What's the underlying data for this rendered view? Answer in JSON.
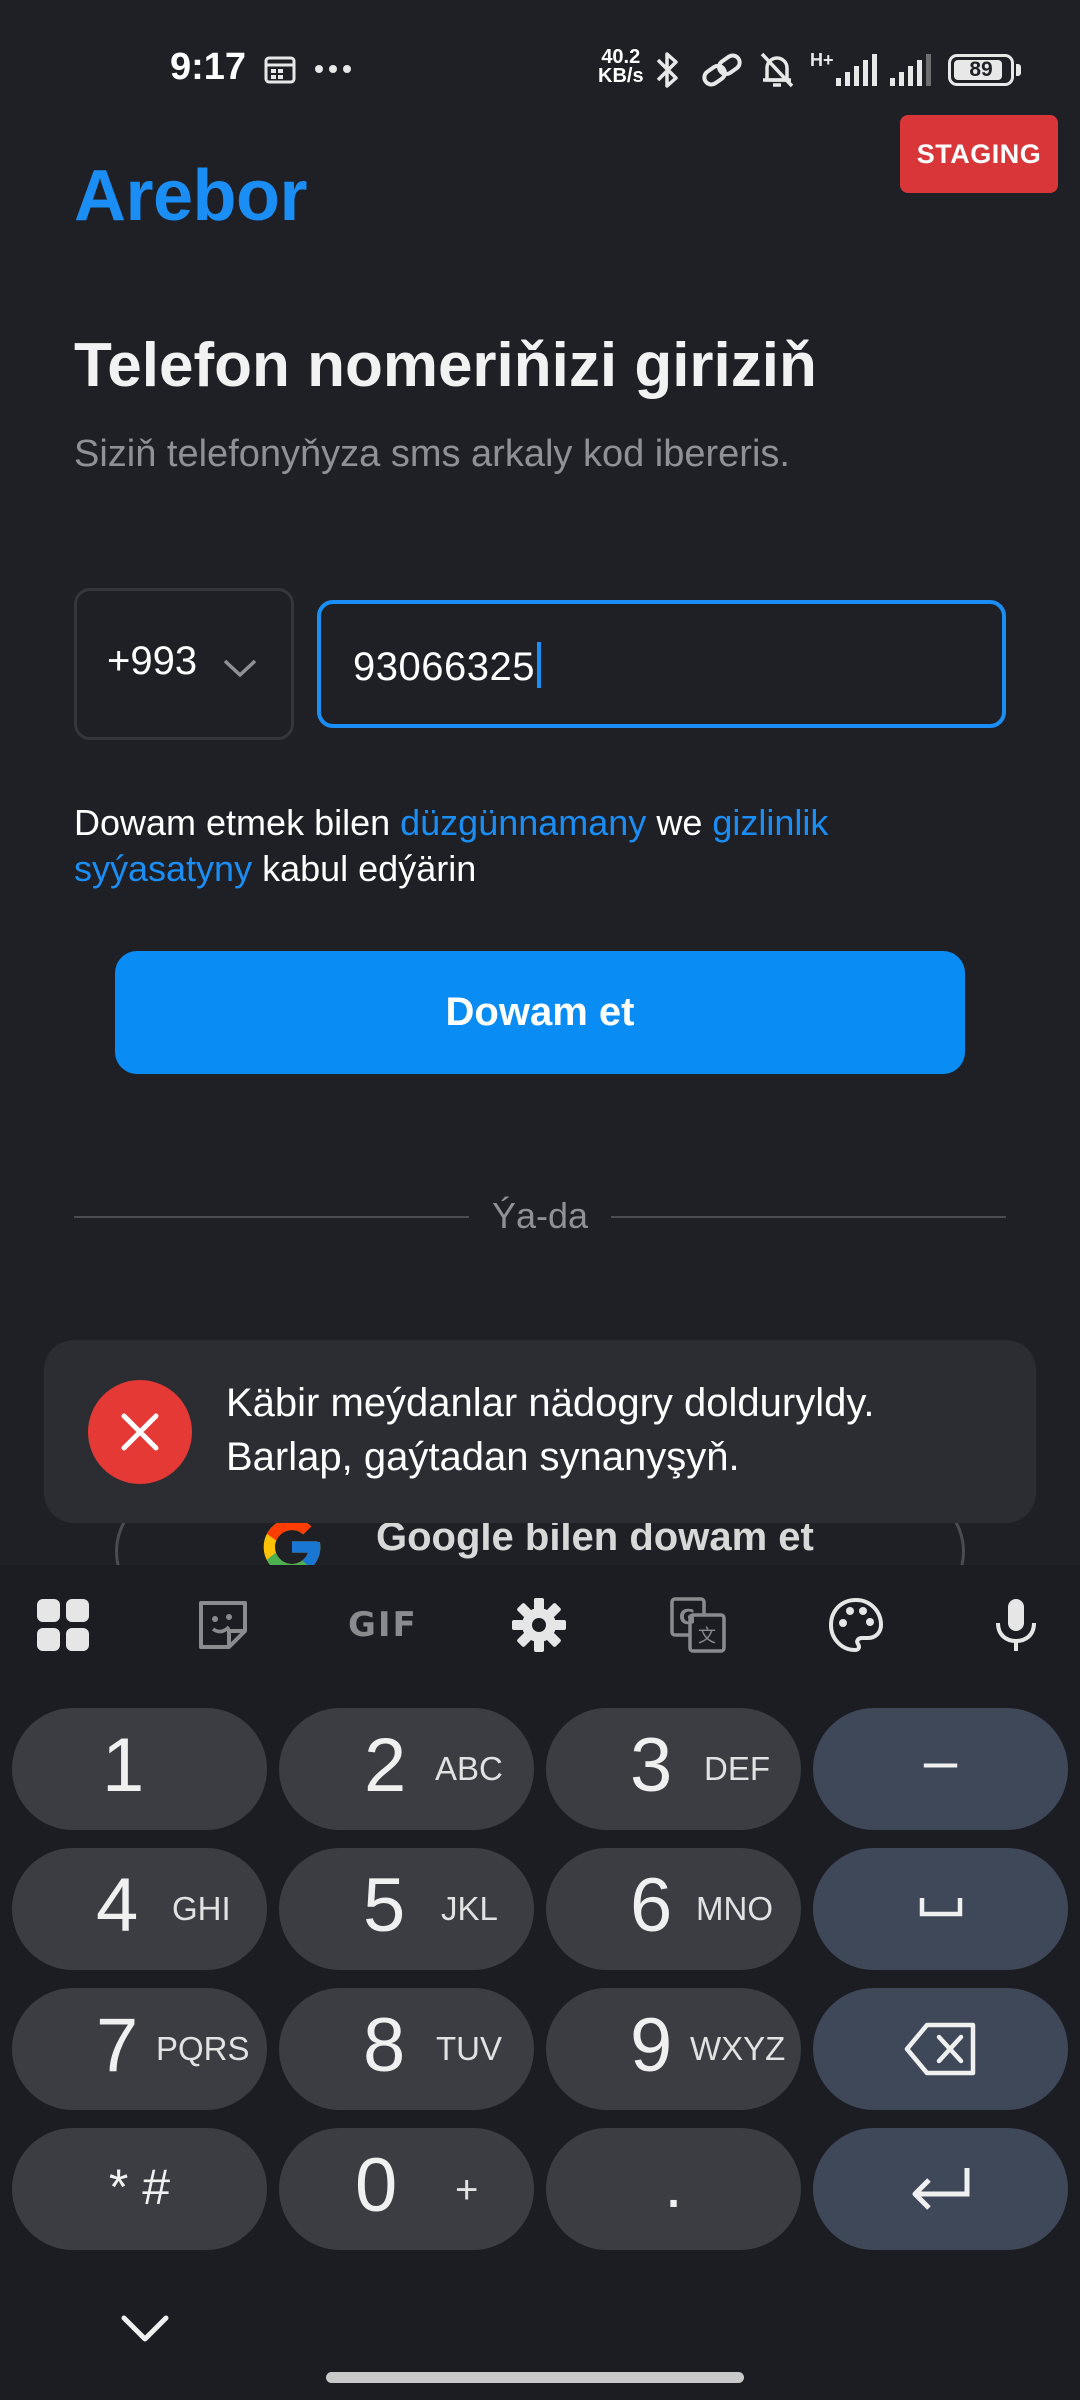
{
  "status_bar": {
    "time": "9:17",
    "net_speed_value": "40.2",
    "net_speed_unit": "KB/s",
    "network_label": "H+",
    "battery": "89",
    "icons": [
      "calendar-icon",
      "more-icon",
      "bluetooth-icon",
      "link-icon",
      "mute-bell-icon",
      "signal-icon",
      "signal-icon",
      "battery-icon"
    ]
  },
  "env_badge": "STAGING",
  "brand": "Arebor",
  "heading": "Telefon nomeriňizi giriziň",
  "subheading": "Siziň telefonyňyza sms arkaly kod ibereris.",
  "country_code": "+993",
  "phone_value": "93066325",
  "terms": {
    "prefix": "Dowam etmek bilen ",
    "terms_link": "düzgünnamany",
    "middle": " we ",
    "privacy_link": "gizlinlik syýasatyny",
    "suffix": " kabul edýärin"
  },
  "continue_label": "Dowam et",
  "divider_label": "Ýa-da",
  "google_label": "Google bilen dowam et",
  "toast_message": "Käbir meýdanlar nädogry dolduryldy. Barlap, gaýtadan synanyşyň.",
  "keyboard": {
    "toolbar": [
      "apps-grid-icon",
      "sticker-icon",
      "gif-icon",
      "settings-gear-icon",
      "translate-icon",
      "palette-icon",
      "mic-icon"
    ],
    "gif_label": "GIF",
    "keys": [
      {
        "digit": "1",
        "letters": ""
      },
      {
        "digit": "2",
        "letters": "ABC"
      },
      {
        "digit": "3",
        "letters": "DEF"
      },
      {
        "digit": "4",
        "letters": "GHI"
      },
      {
        "digit": "5",
        "letters": "JKL"
      },
      {
        "digit": "6",
        "letters": "MNO"
      },
      {
        "digit": "7",
        "letters": "PQRS"
      },
      {
        "digit": "8",
        "letters": "TUV"
      },
      {
        "digit": "9",
        "letters": "WXYZ"
      },
      {
        "digit": "0",
        "letters": "+"
      }
    ],
    "star_hash": "* #",
    "dot": ".",
    "dash": "–",
    "colors": {
      "key": "#3c3d42",
      "special_key": "#3e4859",
      "background": "#1c1d22"
    }
  },
  "colors": {
    "accent": "#1a8ef5",
    "background": "#1f2025",
    "error": "#e53935",
    "staging": "#d9363a"
  }
}
